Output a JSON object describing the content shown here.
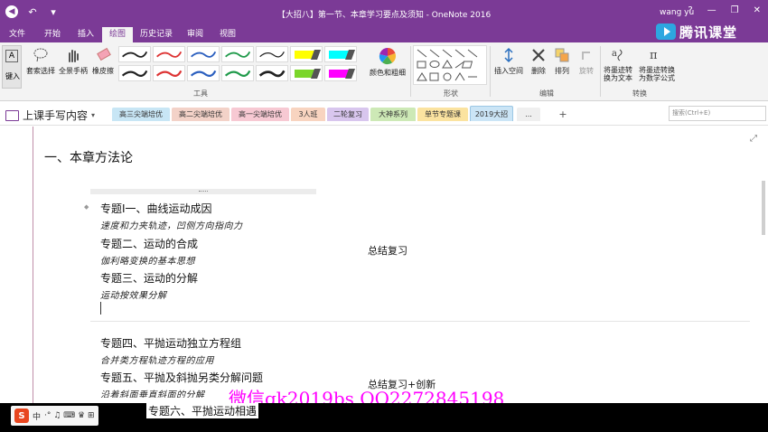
{
  "window": {
    "title": "【大招八】第一节、本章学习要点及须知 - OneNote 2016",
    "user": "wang yu",
    "help_icon": "?",
    "min_icon": "—",
    "max_icon": "❐",
    "close_icon": "✕"
  },
  "quick_access": {
    "back_icon": "◉",
    "undo_icon": "↶",
    "customize_icon": "▾"
  },
  "ribbon_tabs": [
    "文件",
    "开始",
    "插入",
    "绘图",
    "历史记录",
    "审阅",
    "视图"
  ],
  "active_tab": "绘图",
  "brand": {
    "text": "腾讯课堂",
    "color": "#2da7e0"
  },
  "ribbon": {
    "tools": {
      "type_label": "键入",
      "lasso_label": "套索选择",
      "pan_label": "全景手柄",
      "eraser_label": "橡皮擦",
      "group_label": "工具",
      "pen_colors": [
        "#222222",
        "#d33",
        "#2b5fbf",
        "#1f9a4a",
        "#222222",
        "#222222",
        "#d33",
        "#2b5fbf",
        "#1f9a4a",
        "#222222"
      ],
      "highlighter_colors": [
        "#ffff00",
        "#00ffff",
        "#7bd62a",
        "#ff00ff"
      ],
      "color_thickness_label": "颜色和粗细"
    },
    "shapes": {
      "group_label": "形状"
    },
    "edit": {
      "insert_space_label": "插入空间",
      "delete_label": "删除",
      "arrange_label": "排列",
      "rotate_label": "旋转",
      "group_label": "编辑"
    },
    "convert": {
      "ink_to_text_label": "将墨迹转换为文本",
      "ink_to_math_label": "将墨迹转换为数学公式",
      "group_label": "转换"
    }
  },
  "notebook": {
    "name": "上课手写内容",
    "sections": [
      {
        "label": "高三尖端培优",
        "color": "#c8e6f5"
      },
      {
        "label": "高二尖端培优",
        "color": "#f3d2c8"
      },
      {
        "label": "高一尖端培优",
        "color": "#f7c9d3"
      },
      {
        "label": "3人班",
        "color": "#f8d4c0"
      },
      {
        "label": "二轮复习",
        "color": "#d8c6ee"
      },
      {
        "label": "大神系列",
        "color": "#cde9b6"
      },
      {
        "label": "单节专题课",
        "color": "#fbe3a0"
      },
      {
        "label": "2019大招",
        "color": "#cbe5f6"
      }
    ],
    "active_section": "2019大招",
    "more_label": "...",
    "add_label": "+",
    "search_placeholder": "搜索(Ctrl+E)"
  },
  "page": {
    "heading": "一、本章方法论",
    "topics": [
      {
        "title": "专题I一、曲线运动成因",
        "note": "速度和力夹轨迹，凹侧方向指向力"
      },
      {
        "title": "专题二、运动的合成",
        "note": "伽利略变换的基本思想"
      },
      {
        "title": "专题三、运动的分解",
        "note": "运动按效果分解"
      },
      {
        "title": "专题四、平抛运动独立方程组",
        "note": "合并类方程轨迹方程的应用"
      },
      {
        "title": "专题五、平抛及斜抛另类分解问题",
        "note": "沿着斜面垂直斜面的分解"
      },
      {
        "title": "专题六、平抛运动相遇",
        "note": ""
      }
    ],
    "summary_1": "总结复习",
    "summary_2": "总结复习+创新",
    "watermark": "微信gk2019bs  QQ2272845198"
  },
  "taskbar": {
    "ime_label": "中",
    "ime_extra": "·° ♫ ⌨ ♛ ⊞"
  }
}
